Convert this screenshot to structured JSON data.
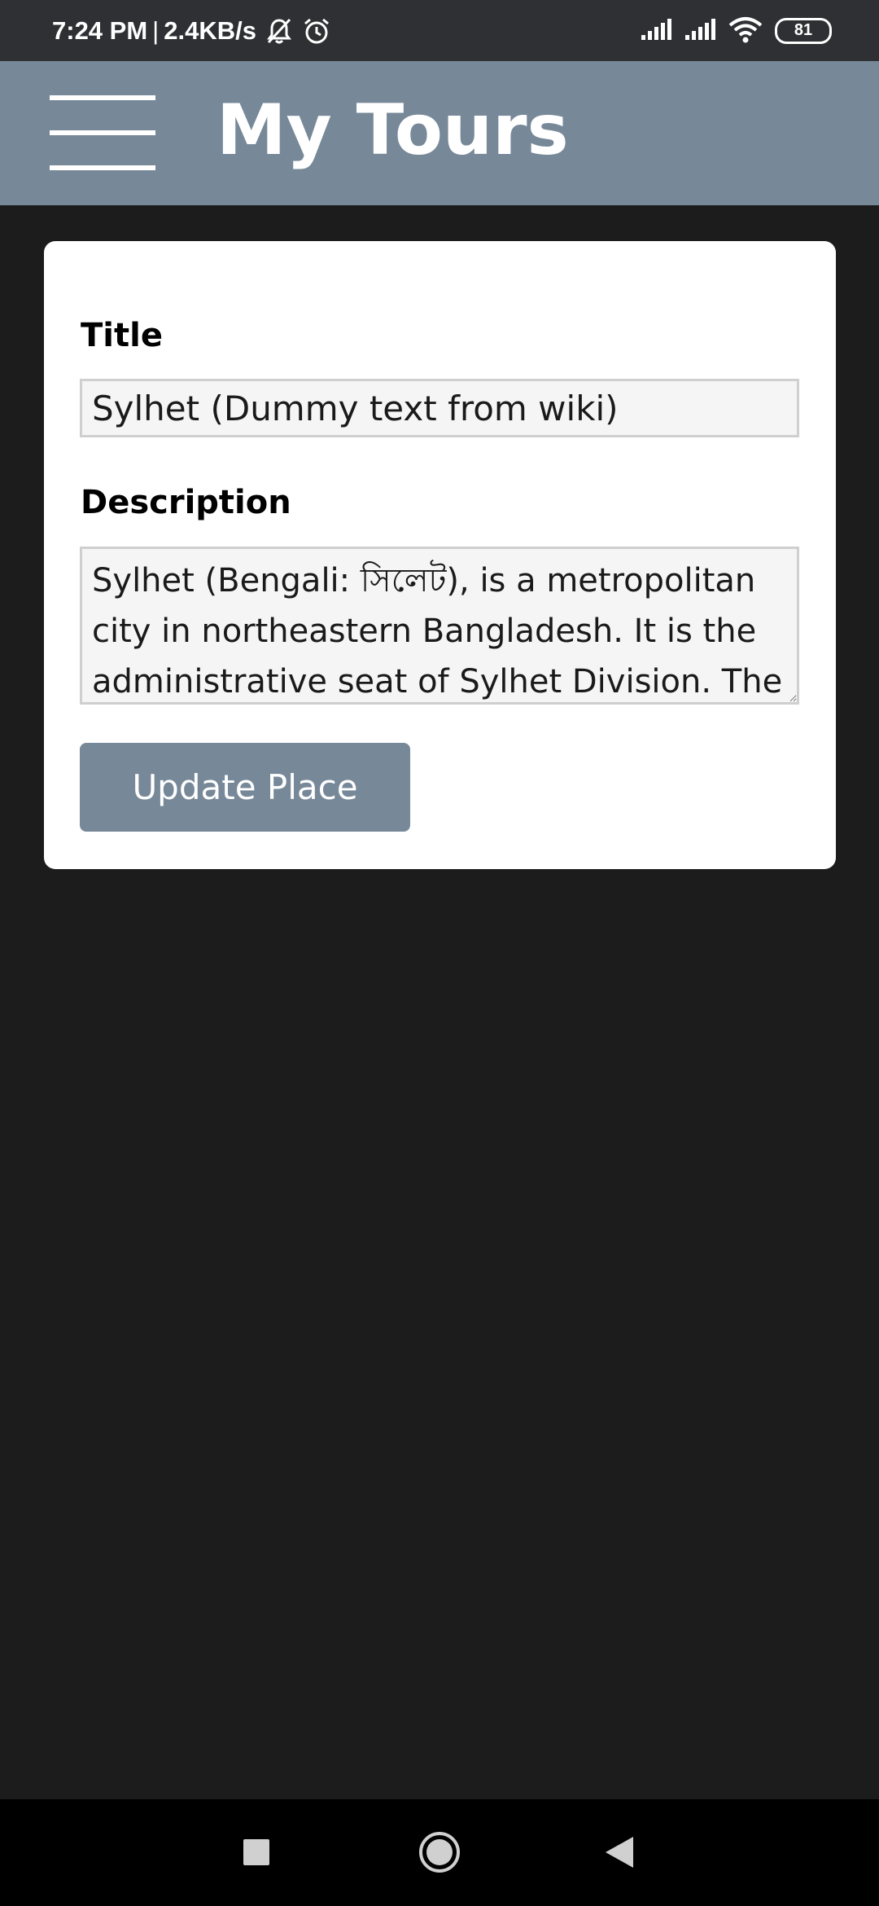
{
  "status_bar": {
    "time": "7:24 PM",
    "separator": "|",
    "network_speed": "2.4KB/s",
    "battery_level": "81",
    "icons": [
      "bell-off-icon",
      "alarm-icon",
      "signal-icon",
      "signal-icon",
      "wifi-icon",
      "battery-icon"
    ]
  },
  "header": {
    "title": "My Tours",
    "menu_icon": "hamburger-menu-icon",
    "background": "#778899"
  },
  "form": {
    "title_label": "Title",
    "title_value": "Sylhet (Dummy text from wiki)",
    "description_label": "Description",
    "description_value": "Sylhet (Bengali: সিলেট), is a metropolitan city in northeastern Bangladesh. It is the administrative seat of Sylhet Division. The",
    "submit_label": "Update Place",
    "accent_color": "#778899"
  },
  "nav_bar": {
    "icons": [
      "recents-square-icon",
      "home-circle-icon",
      "back-triangle-icon"
    ]
  }
}
